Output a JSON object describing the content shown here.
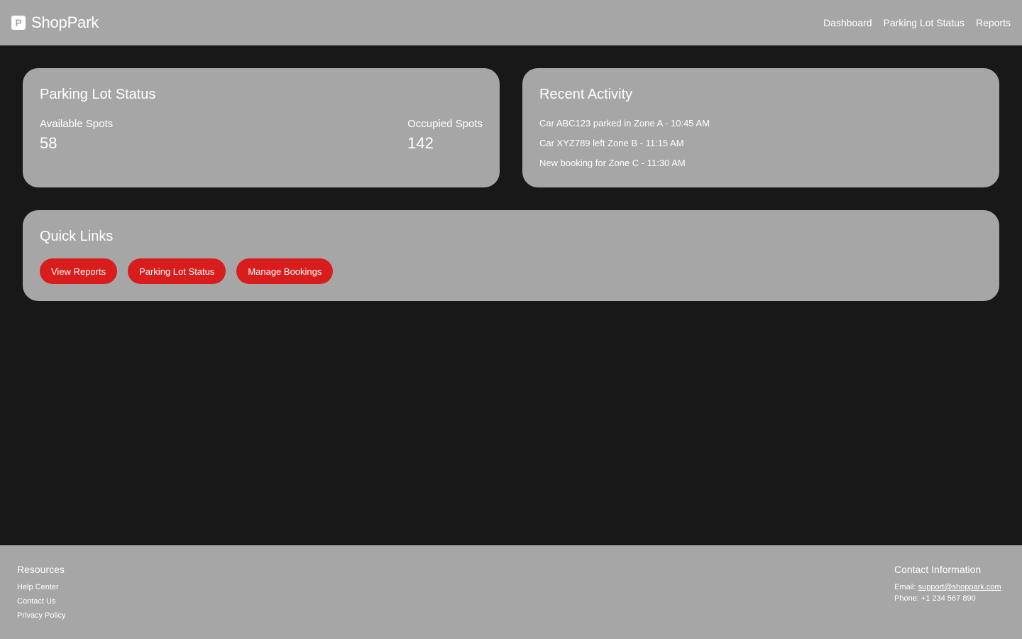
{
  "app": {
    "brand_icon_letter": "P",
    "brand_name": "ShopPark"
  },
  "nav": {
    "items": [
      "Dashboard",
      "Parking Lot Status",
      "Reports"
    ]
  },
  "status_card": {
    "title": "Parking Lot Status",
    "available_label": "Available Spots",
    "available_value": "58",
    "occupied_label": "Occupied Spots",
    "occupied_value": "142"
  },
  "activity_card": {
    "title": "Recent Activity",
    "items": [
      "Car ABC123 parked in Zone A - 10:45 AM",
      "Car XYZ789 left Zone B - 11:15 AM",
      "New booking for Zone C - 11:30 AM"
    ]
  },
  "quick_links": {
    "title": "Quick Links",
    "buttons": [
      "View Reports",
      "Parking Lot Status",
      "Manage Bookings"
    ]
  },
  "footer": {
    "resources_heading": "Resources",
    "resources_links": [
      "Help Center",
      "Contact Us",
      "Privacy Policy"
    ],
    "contact_heading": "Contact Information",
    "email_label": "Email: ",
    "email_value": "support@shoppark.com",
    "phone_text": "Phone: +1 234 567 890"
  },
  "colors": {
    "background": "#181818",
    "panel": "#a6a6a6",
    "accent": "#d91c1c",
    "text": "#ffffff"
  }
}
